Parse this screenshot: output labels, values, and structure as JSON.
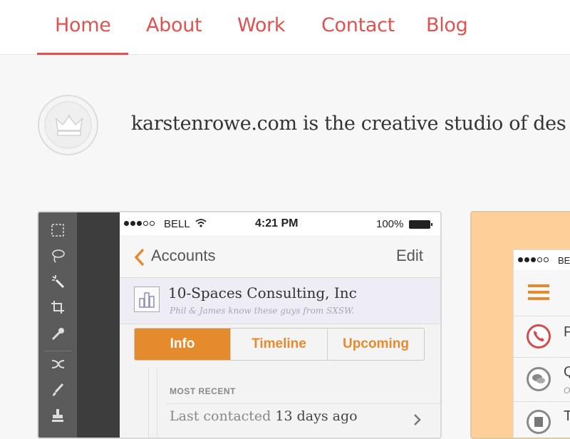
{
  "nav": {
    "items": [
      {
        "label": "Home",
        "active": true
      },
      {
        "label": "About"
      },
      {
        "label": "Work"
      },
      {
        "label": "Contact"
      },
      {
        "label": "Blog"
      }
    ]
  },
  "intro": {
    "text": "karstenrowe.com is the creative studio of des"
  },
  "card1": {
    "toolbar_tools": [
      "marquee-icon",
      "lasso-icon",
      "magic-wand-icon",
      "crop-icon",
      "eyedropper-icon",
      "heal-icon",
      "brush-icon",
      "stamp-icon"
    ],
    "status": {
      "carrier": "BELL",
      "time": "4:21 PM",
      "battery": "100%"
    },
    "navbar": {
      "back_label": "Accounts",
      "edit_label": "Edit"
    },
    "company": {
      "name": "10-Spaces Consulting, Inc",
      "note": "Phil & James know these guys from SXSW."
    },
    "tabs": [
      {
        "label": "Info",
        "active": true
      },
      {
        "label": "Timeline"
      },
      {
        "label": "Upcoming"
      }
    ],
    "section_heading": "MOST RECENT",
    "last_contact": {
      "label": "Last contacted",
      "value": "13 days ago"
    }
  },
  "card2": {
    "status": {
      "carrier": "BE"
    },
    "rows": [
      {
        "title": "P",
        "icon": "phone-icon"
      },
      {
        "title": "Q",
        "sub": "O",
        "icon": "chat-icon"
      },
      {
        "title": "T",
        "icon": "note-icon"
      }
    ]
  },
  "colors": {
    "brand_red": "#e0524f",
    "accent_orange": "#e68a2e",
    "card2_bg": "#fecf98"
  }
}
